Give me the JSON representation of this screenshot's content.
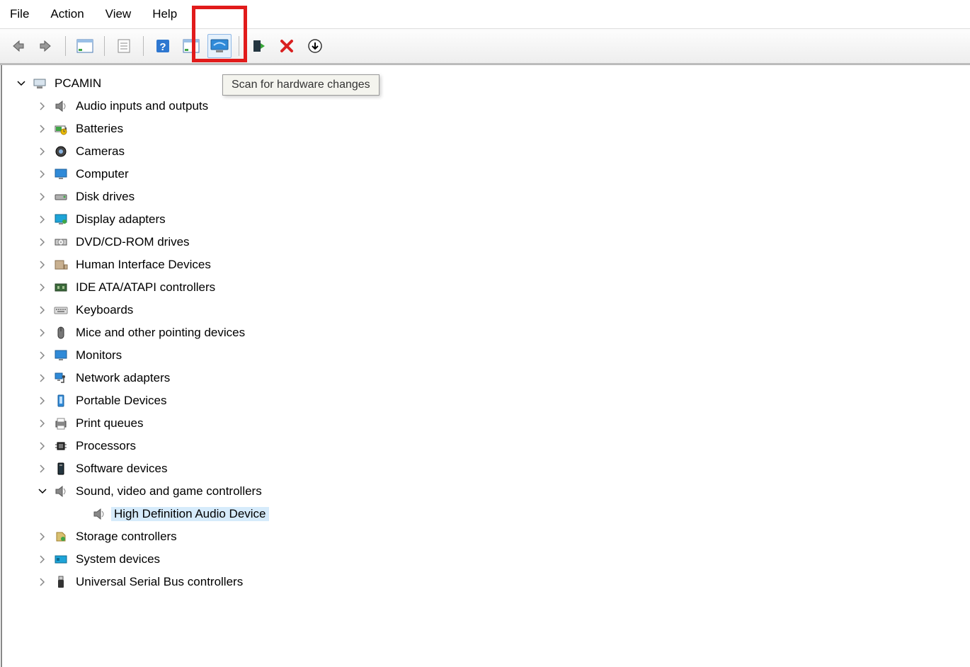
{
  "menu": {
    "file": "File",
    "action": "Action",
    "view": "View",
    "help": "Help"
  },
  "toolbar": {
    "back": "Back",
    "forward": "Forward",
    "show_hidden": "Show hidden devices",
    "properties": "Properties",
    "help": "Help",
    "update_driver": "Update driver",
    "scan": "Scan for hardware changes",
    "add_legacy": "Add legacy hardware",
    "uninstall": "Uninstall device",
    "disable": "Disable device"
  },
  "tooltip": "Scan for hardware changes",
  "tree": {
    "root": "PCAMIN",
    "items": [
      {
        "label": "Audio inputs and outputs",
        "icon": "speaker"
      },
      {
        "label": "Batteries",
        "icon": "battery"
      },
      {
        "label": "Cameras",
        "icon": "camera"
      },
      {
        "label": "Computer",
        "icon": "monitor"
      },
      {
        "label": "Disk drives",
        "icon": "disk"
      },
      {
        "label": "Display adapters",
        "icon": "display"
      },
      {
        "label": "DVD/CD-ROM drives",
        "icon": "dvd"
      },
      {
        "label": "Human Interface Devices",
        "icon": "hid"
      },
      {
        "label": "IDE ATA/ATAPI controllers",
        "icon": "ide"
      },
      {
        "label": "Keyboards",
        "icon": "keyboard"
      },
      {
        "label": "Mice and other pointing devices",
        "icon": "mouse"
      },
      {
        "label": "Monitors",
        "icon": "monitor"
      },
      {
        "label": "Network adapters",
        "icon": "network"
      },
      {
        "label": "Portable Devices",
        "icon": "portable"
      },
      {
        "label": "Print queues",
        "icon": "printer"
      },
      {
        "label": "Processors",
        "icon": "cpu"
      },
      {
        "label": "Software devices",
        "icon": "software"
      },
      {
        "label": "Sound, video and game controllers",
        "icon": "speaker",
        "expanded": true,
        "children": [
          {
            "label": "High Definition Audio Device",
            "icon": "speaker",
            "selected": true
          }
        ]
      },
      {
        "label": "Storage controllers",
        "icon": "storage"
      },
      {
        "label": "System devices",
        "icon": "system"
      },
      {
        "label": "Universal Serial Bus controllers",
        "icon": "usb"
      }
    ]
  }
}
